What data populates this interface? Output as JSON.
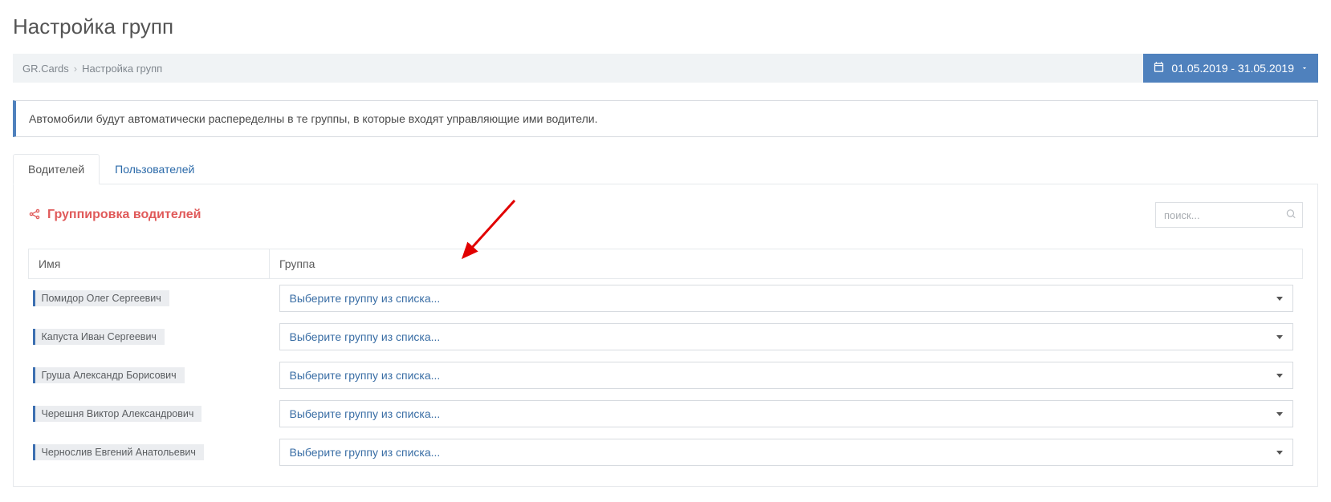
{
  "page": {
    "title": "Настройка групп"
  },
  "breadcrumb": {
    "root": "GR.Cards",
    "current": "Настройка групп"
  },
  "date_range": {
    "text": "01.05.2019 -  31.05.2019"
  },
  "info": {
    "text": "Автомобили будут автоматически распеределны в те группы, в которые входят управляющие ими водители."
  },
  "tabs": {
    "drivers": "Водителей",
    "users": "Пользователей"
  },
  "panel": {
    "title": "Группировка водителей"
  },
  "search": {
    "placeholder": "поиск..."
  },
  "table": {
    "headers": {
      "name": "Имя",
      "group": "Группа"
    },
    "select_placeholder": "Выберите группу из списка...",
    "rows": [
      {
        "name": "Помидор Олег Сергеевич"
      },
      {
        "name": "Капуста Иван Сергеевич"
      },
      {
        "name": "Груша Александр Борисович"
      },
      {
        "name": "Черешня Виктор Александрович"
      },
      {
        "name": "Чернослив Евгений Анатольевич"
      }
    ]
  }
}
